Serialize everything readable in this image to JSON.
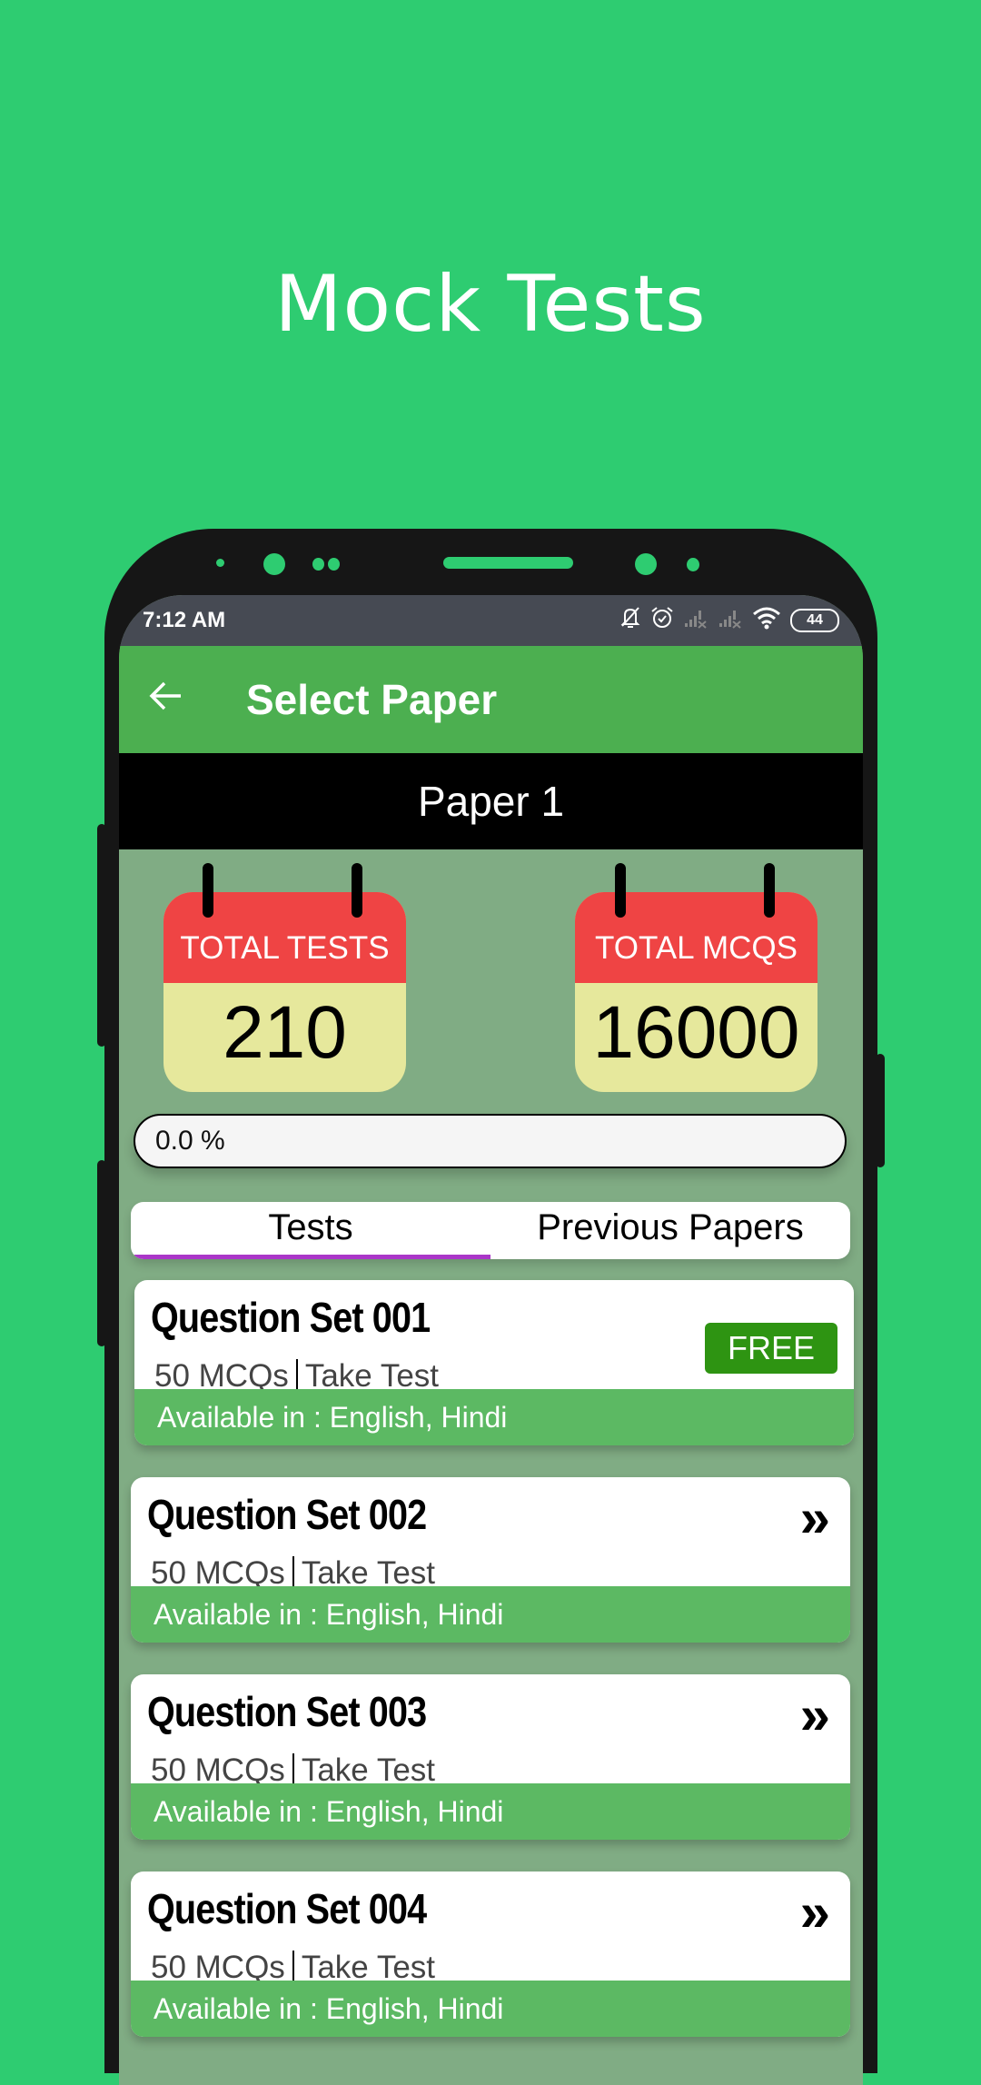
{
  "promo": {
    "title": "Mock Tests"
  },
  "status_bar": {
    "time": "7:12 AM",
    "icons": [
      "bell-muted-icon",
      "alarm-icon",
      "signal-none-icon",
      "signal-none-icon",
      "wifi-icon",
      "battery-icon"
    ],
    "battery_level": "44"
  },
  "app_bar": {
    "back_icon": "arrow-left-icon",
    "title": "Select Paper"
  },
  "paper": {
    "name": "Paper 1"
  },
  "stats": {
    "total_tests_label": "TOTAL TESTS",
    "total_tests_value": "210",
    "total_mcqs_label": "TOTAL MCQS",
    "total_mcqs_value": "16000"
  },
  "progress": {
    "text": "0.0 %",
    "value_percent": 0.0
  },
  "tabs": [
    {
      "label": "Tests",
      "active": true
    },
    {
      "label": "Previous Papers",
      "active": false
    }
  ],
  "question_sets": [
    {
      "title": "Question Set 001",
      "mcqs": "50 MCQs",
      "action": "Take Test",
      "availability": "Available in : English, Hindi",
      "badge": "FREE"
    },
    {
      "title": "Question Set 002",
      "mcqs": "50 MCQs",
      "action": "Take Test",
      "availability": "Available in : English, Hindi",
      "badge": "»"
    },
    {
      "title": "Question Set 003",
      "mcqs": "50 MCQs",
      "action": "Take Test",
      "availability": "Available in : English, Hindi",
      "badge": "»"
    },
    {
      "title": "Question Set 004",
      "mcqs": "50 MCQs",
      "action": "Take Test",
      "availability": "Available in : English, Hindi",
      "badge": "»"
    }
  ],
  "colors": {
    "background": "#2ecc71",
    "app_bar": "#4caf50",
    "content_bg": "#80ac84",
    "calendar_header": "#ef4444",
    "calendar_body": "#e6e89c",
    "free_badge": "#2e9412",
    "tab_indicator": "#aa36c8",
    "availability_bar": "#5cb963"
  }
}
